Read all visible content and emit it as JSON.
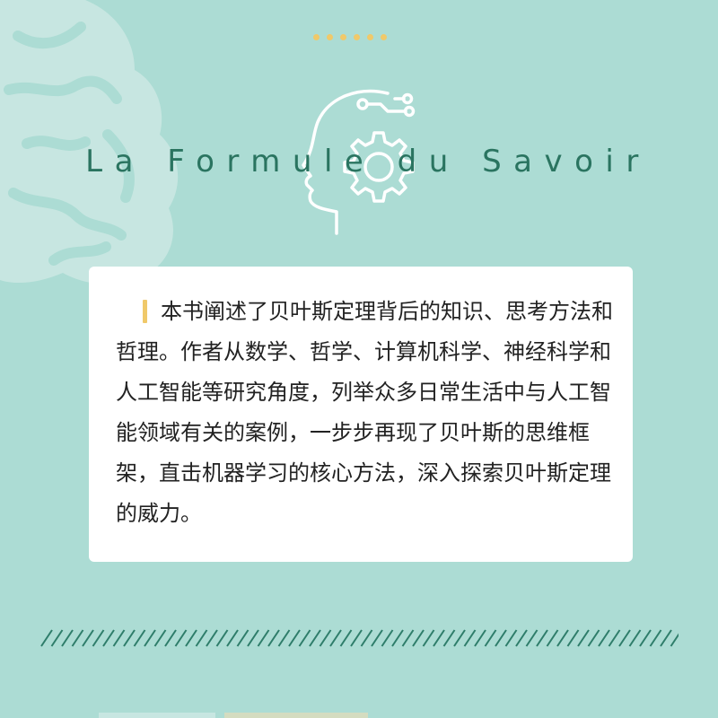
{
  "title": "La Formule du Savoir",
  "description": "本书阐述了贝叶斯定理背后的知识、思考方法和哲理。作者从数学、哲学、计算机科学、神经科学和人工智能等研究角度，列举众多日常生活中与人工智能领域有关的案例，一步步再现了贝叶斯的思维框架，直击机器学习的核心方法，深入探索贝叶斯定理的威力。",
  "icons": [
    "brain-icon",
    "head-gear-icon",
    "circuit-icon"
  ],
  "colors": {
    "background": "#acdcd4",
    "brain": "#c7e6e1",
    "accent_gold": "#f0c96a",
    "title": "#2a7460",
    "divider": "#2e7d6a",
    "card": "#ffffff"
  },
  "decor": {
    "dot_count": 6
  }
}
